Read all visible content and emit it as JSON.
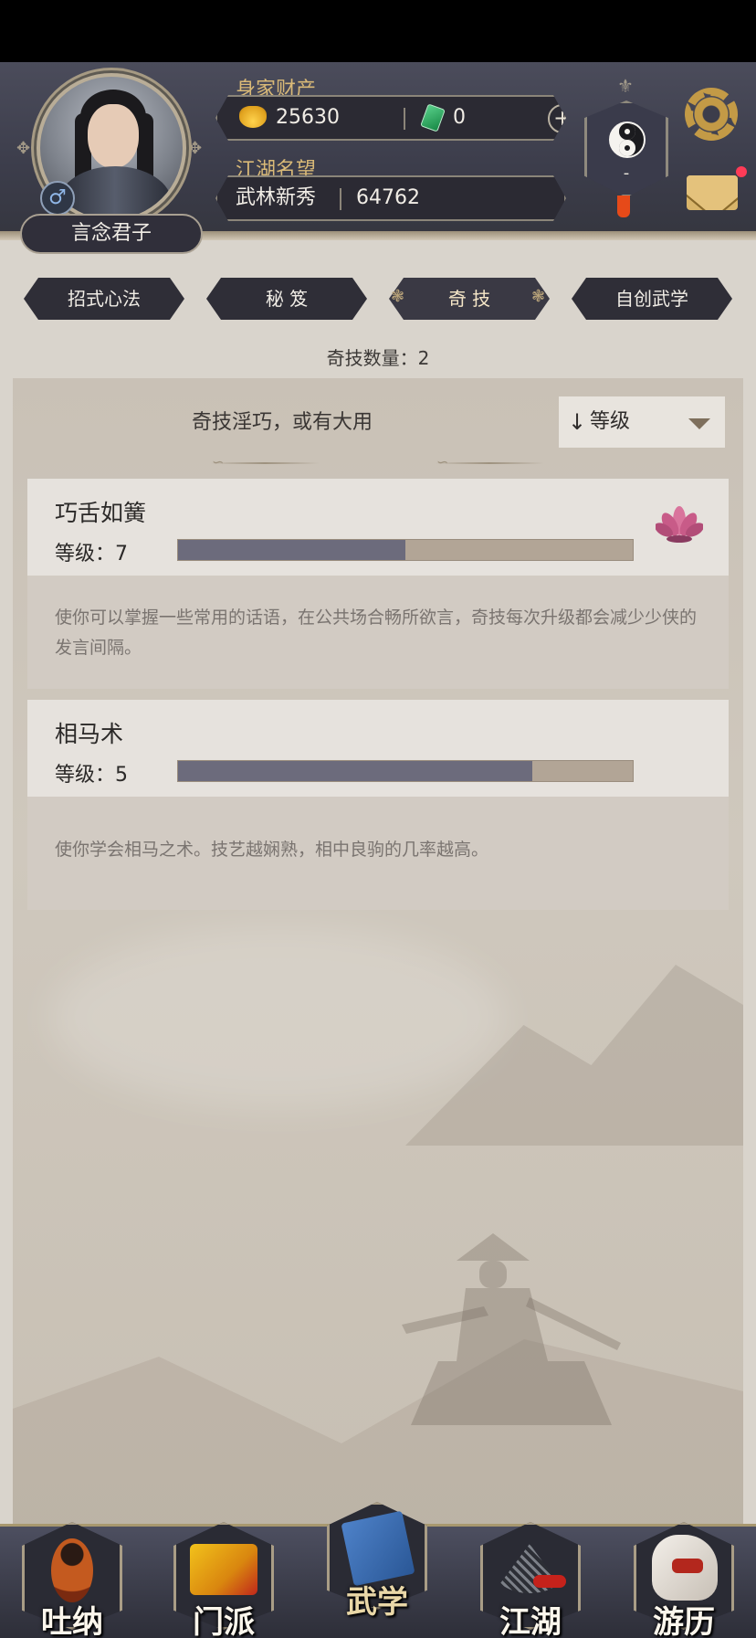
{
  "header": {
    "player_name": "言念君子",
    "gender_symbol": "♂",
    "wealth_label": "身家财产",
    "gold": "25630",
    "jade": "0",
    "add_symbol": "+",
    "reputation_label": "江湖名望",
    "rank_title": "武林新秀",
    "reputation": "64762",
    "sect_value": "-",
    "has_new_mail": true
  },
  "tabs": [
    {
      "label": "招式心法",
      "active": false
    },
    {
      "label": "秘 笈",
      "active": false
    },
    {
      "label": "奇 技",
      "active": true
    },
    {
      "label": "自创武学",
      "active": false
    }
  ],
  "count_label": "奇技数量：2",
  "panel": {
    "motto": "奇技淫巧，或有大用",
    "sort": {
      "arrow": "↓",
      "label": "等级"
    }
  },
  "skills": [
    {
      "name": "巧舌如簧",
      "level_text": "等级：7",
      "progress": 0.5,
      "description": "使你可以掌握一些常用的话语，在公共场合畅所欲言，奇技每次升级都会减少少侠的发言间隔。",
      "badge_icon": "lotus-icon"
    },
    {
      "name": "相马术",
      "level_text": "等级：5",
      "progress": 0.78,
      "description": "使你学会相马之术。技艺越娴熟，相中良驹的几率越高。"
    }
  ],
  "bottom_nav": [
    {
      "label": "吐纳",
      "icon": "meditating-monk-icon",
      "active": false
    },
    {
      "label": "门派",
      "icon": "sect-banner-icon",
      "active": false
    },
    {
      "label": "武学",
      "icon": "martial-book-icon",
      "active": true
    },
    {
      "label": "江湖",
      "icon": "straw-hat-icon",
      "active": false
    },
    {
      "label": "游历",
      "icon": "horse-icon",
      "active": false
    }
  ],
  "colors": {
    "header_bg": "#3c3d4b",
    "gold_text": "#d9b977",
    "panel_bg": "#cfc8bd",
    "progress_fill": "#6c6b7c",
    "progress_track": "#b2a596",
    "mail_badge": "#ff3b57"
  }
}
